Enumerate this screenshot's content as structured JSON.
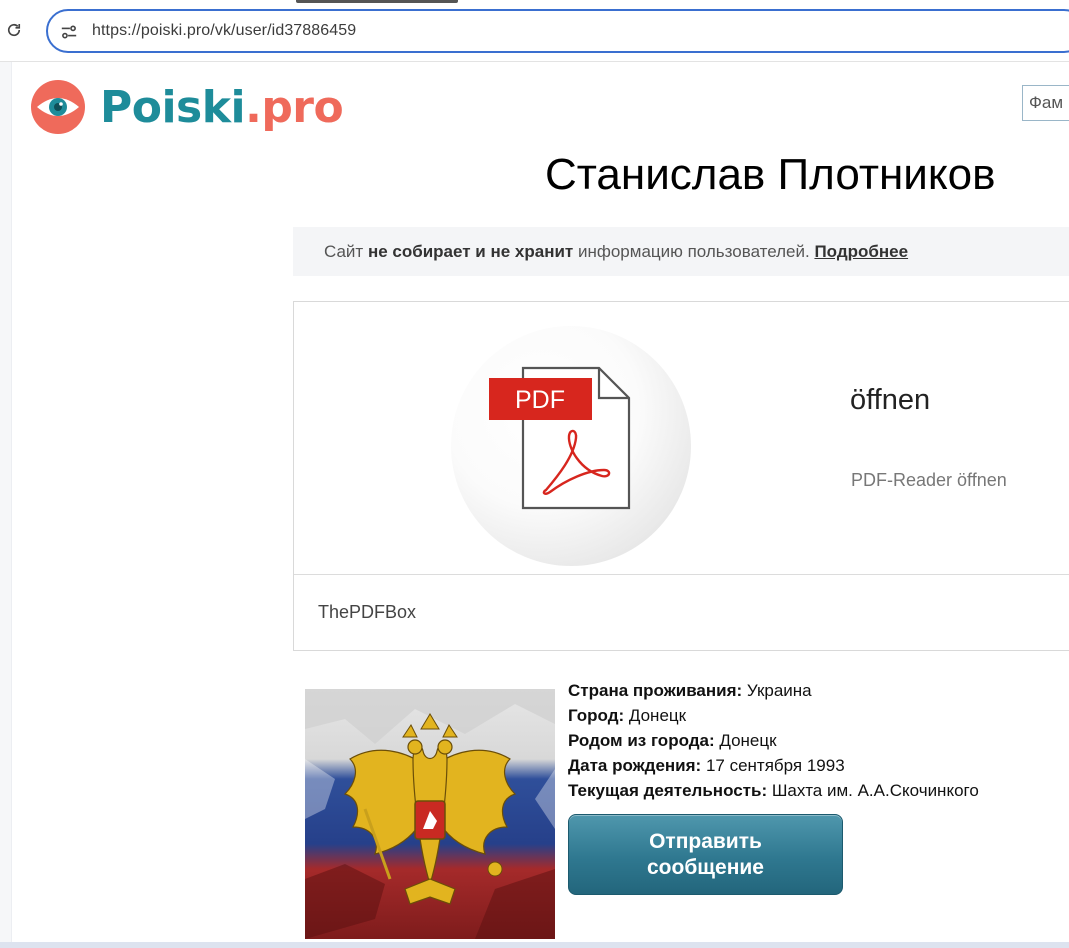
{
  "browser": {
    "url": "https://poiski.pro/vk/user/id37886459"
  },
  "logo": {
    "text_main": "Poiski",
    "text_dot": ".",
    "text_pro": "pro"
  },
  "search": {
    "placeholder": "Фам"
  },
  "profile": {
    "name": "Станислав Плотников"
  },
  "notice": {
    "prefix": "Сайт ",
    "bold": "не собирает и не хранит",
    "suffix": " информацию пользователей. ",
    "link": "Подробнее"
  },
  "ad": {
    "pdf_label": "PDF",
    "heading": "öffnen",
    "subheading": "PDF-Reader öffnen",
    "brand": "ThePDFBox"
  },
  "info": {
    "country_label": "Страна проживания:",
    "country_value": " Украина",
    "city_label": "Город:",
    "city_value": " Донецк",
    "hometown_label": "Родом из города:",
    "hometown_value": " Донецк",
    "birthdate_label": "Дата рождения:",
    "birthdate_value": " 17 сентября 1993",
    "occupation_label": "Текущая деятельность:",
    "occupation_value": " Шахта им. А.А.Скочинкого"
  },
  "send_button": {
    "line1": "Отправить",
    "line2": "сообщение"
  },
  "colors": {
    "brand_teal": "#1e8c9a",
    "brand_coral": "#ef6a5b",
    "button": "#2f7890",
    "url_focus": "#3a6fd0",
    "pdf_red": "#d7261e"
  }
}
